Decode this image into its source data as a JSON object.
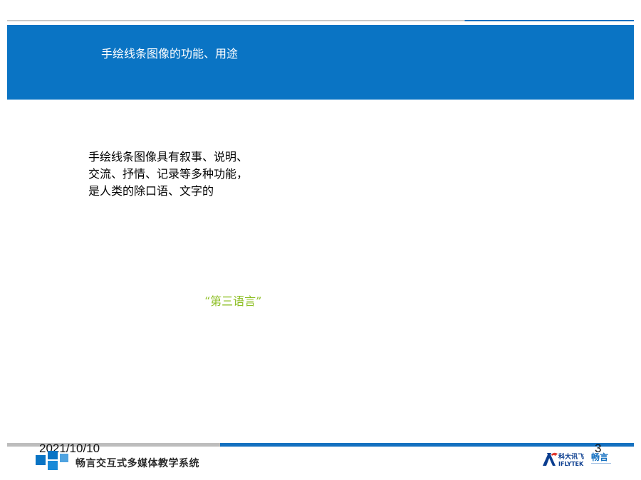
{
  "header": {
    "title": "手绘线条图像的功能、用途"
  },
  "content": {
    "lines": [
      "手绘线条图像具有叙事、说明、",
      "交流、抒情、记录等多种功能，",
      "是人类的除口语、文字的"
    ],
    "highlight": "“第三语言”"
  },
  "footer": {
    "date": "2021/10/10",
    "page_number": "3",
    "system_name": "畅言交互式多媒体教学系统",
    "brand": {
      "cn": "科大讯飞",
      "en": "IFLYTEK",
      "product": "畅言"
    }
  },
  "colors": {
    "header_band": "#0a74c4",
    "highlight_text": "#8cbe22",
    "rule_gray": "#c8c8c8",
    "rule_blue": "#1470c0"
  }
}
